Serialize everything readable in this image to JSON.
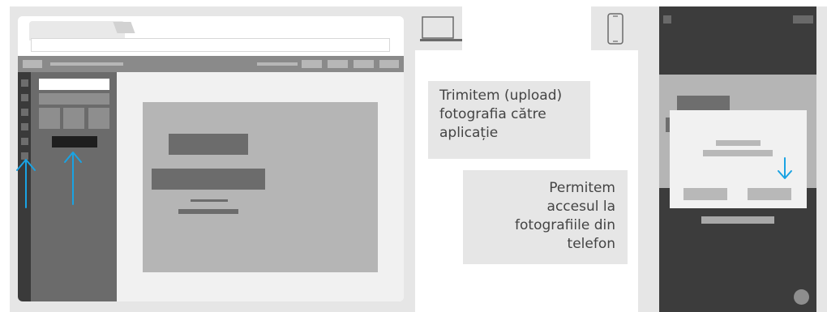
{
  "desktop": {
    "description_icon": "laptop-icon"
  },
  "mobile": {
    "description_icon": "phone-icon"
  },
  "captions": {
    "upload_lines": [
      "Trimitem (upload)",
      "fotografia către",
      "aplicație"
    ],
    "access_lines": [
      "Permitem",
      "accesul la",
      "fotografiile din",
      "telefon"
    ]
  },
  "colors": {
    "arrow": "#1aa3e3",
    "panel_bg": "#e6e6e6",
    "text": "#444444"
  }
}
